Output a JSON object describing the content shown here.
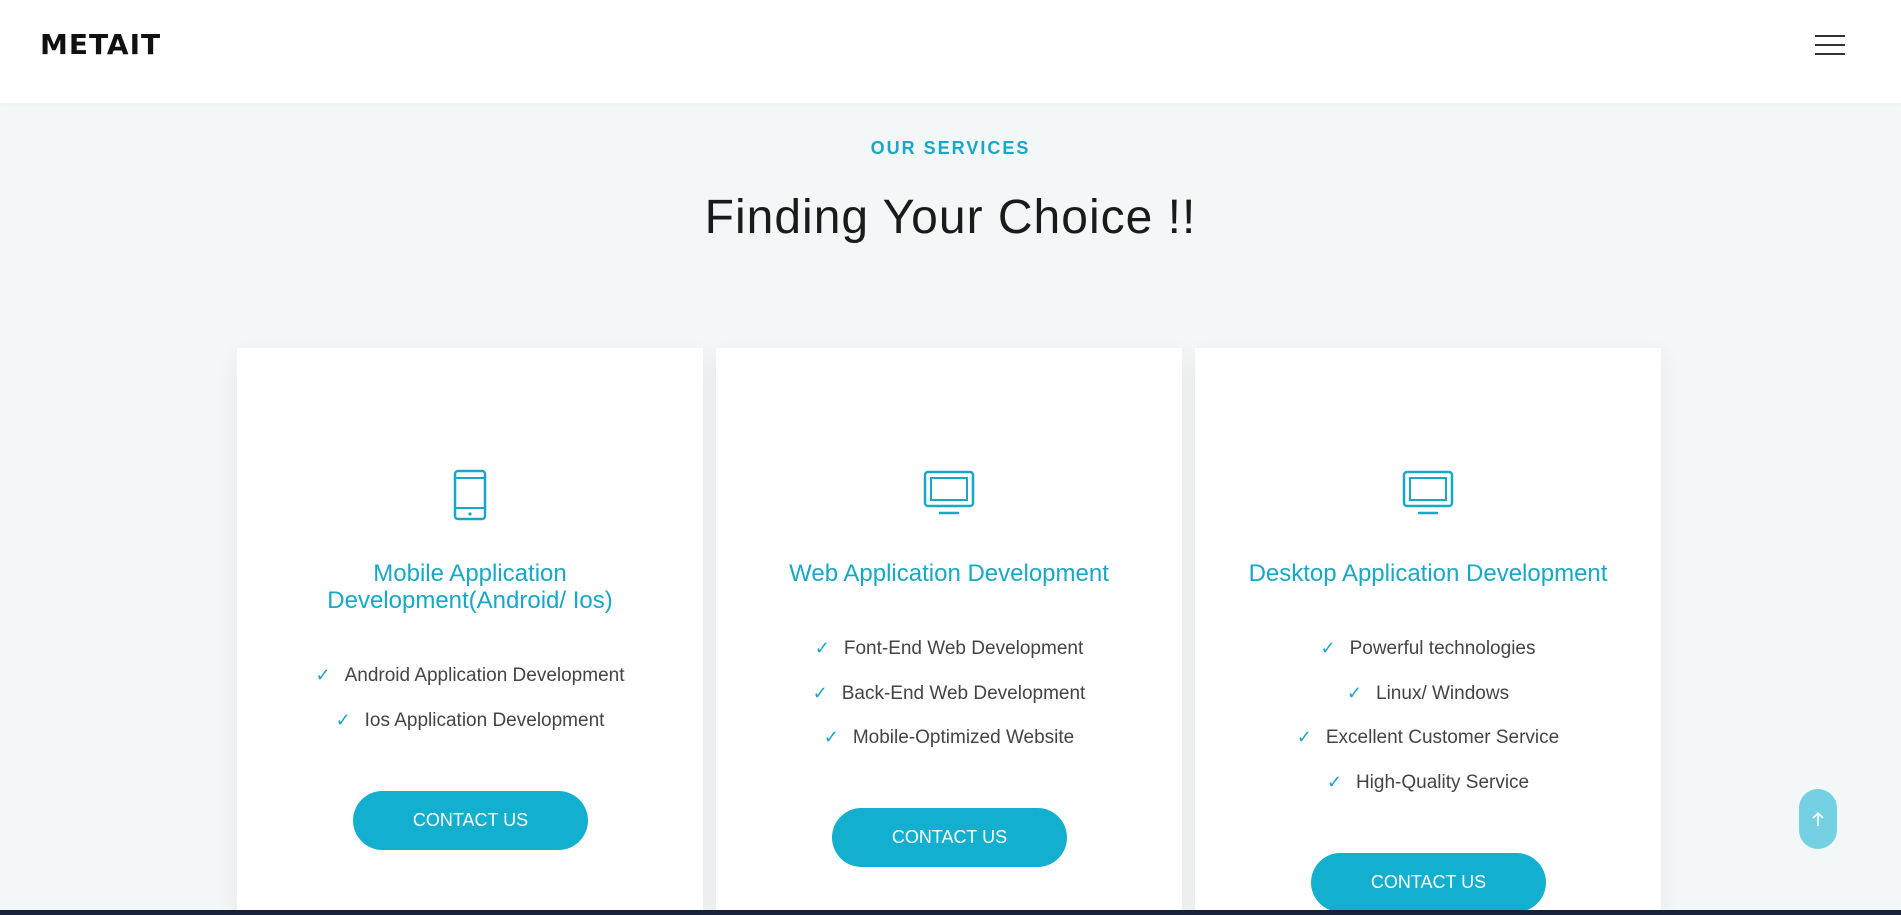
{
  "header": {
    "logo_text": "METAIT",
    "menu_icon": "hamburger-menu-icon"
  },
  "section": {
    "eyebrow": "OUR SERVICES",
    "title": "Finding Your Choice !!"
  },
  "cards": [
    {
      "icon": "mobile-phone-icon",
      "title_line1": "Mobile Application",
      "title_line2": "Development(Android/ Ios)",
      "features": [
        "Android Application Development",
        "Ios Application Development"
      ],
      "button_label": "CONTACT US"
    },
    {
      "icon": "monitor-icon",
      "title": "Web Application Development",
      "features": [
        "Font-End Web Development",
        "Back-End Web Development",
        "Mobile-Optimized Website"
      ],
      "button_label": "CONTACT US"
    },
    {
      "icon": "monitor-icon",
      "title": "Desktop Application Development",
      "features": [
        "Powerful technologies",
        "Linux/ Windows",
        "Excellent Customer Service",
        "High-Quality Service"
      ],
      "button_label": "CONTACT US"
    }
  ],
  "check_glyph": "✓",
  "scroll_top_icon": "arrow-up-icon",
  "colors": {
    "accent": "#17a8c7",
    "button": "#12afcf",
    "page_bg": "#f3f7f7",
    "scroll_top_bg": "#74d0e3"
  }
}
